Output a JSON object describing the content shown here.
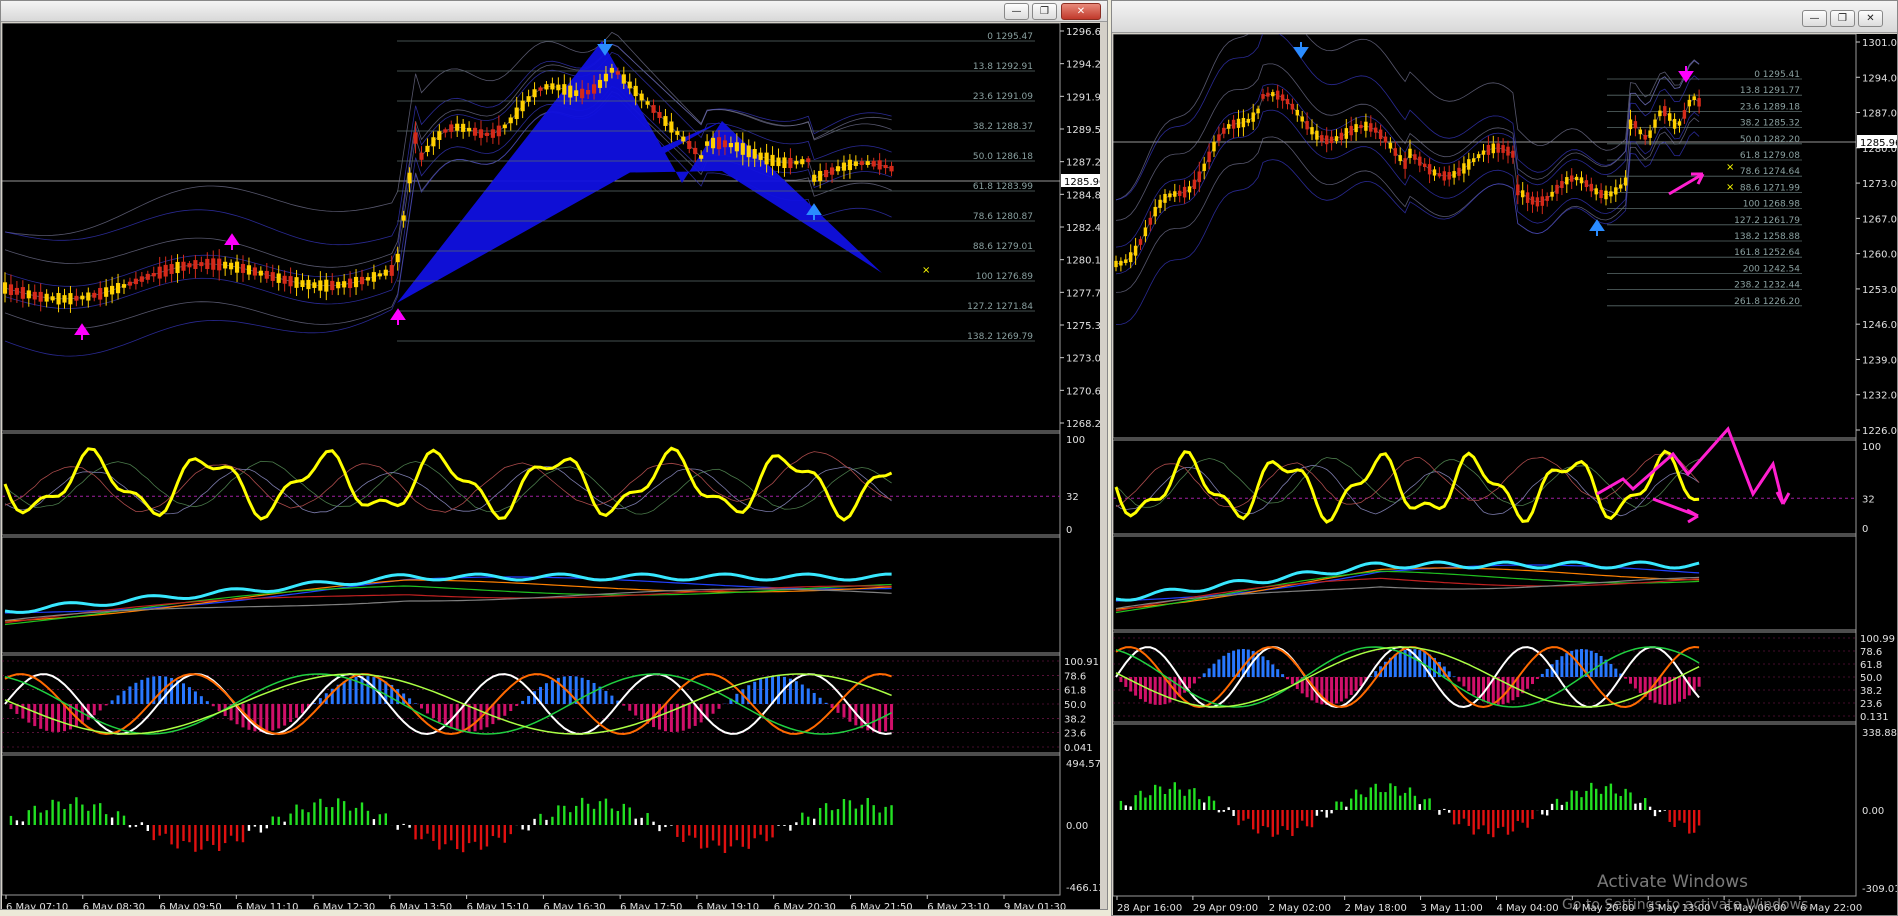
{
  "windows": {
    "left": {
      "main_price_labels": [
        "1296.65",
        "1294.25",
        "1291.90",
        "1289.55",
        "1287.20",
        "1284.80",
        "1282.45",
        "1280.10",
        "1277.75",
        "1275.35",
        "1273.00",
        "1270.65",
        "1268.25"
      ],
      "current_price": "1285.96",
      "fib_labels": [
        "0 1295.47",
        "13.8 1292.91",
        "23.6 1291.09",
        "38.2 1288.37",
        "50.0 1286.18",
        "61.8 1283.99",
        "78.6 1280.87",
        "88.6 1279.01",
        "100 1276.89",
        "127.2 1271.84",
        "138.2 1269.79"
      ],
      "rsi_labels": [
        "100",
        "32",
        "0"
      ],
      "stoch_labels": [
        "100.91",
        "78.6",
        "61.8",
        "50.0",
        "38.2",
        "23.6",
        "0.041"
      ],
      "hist_labels": [
        "494.57",
        "0.00",
        "-466.13"
      ],
      "time_labels": [
        "6 May 07:10",
        "6 May 08:30",
        "6 May 09:50",
        "6 May 11:10",
        "6 May 12:30",
        "6 May 13:50",
        "6 May 15:10",
        "6 May 16:30",
        "6 May 17:50",
        "6 May 19:10",
        "6 May 20:30",
        "6 May 21:50",
        "6 May 23:10",
        "9 May 01:30"
      ]
    },
    "right": {
      "main_price_labels": [
        "1301.00",
        "1294.00",
        "1287.00",
        "1280.00",
        "1273.00",
        "1267.00",
        "1260.00",
        "1253.00",
        "1246.00",
        "1239.00",
        "1232.00",
        "1226.00"
      ],
      "current_price": "1285.96",
      "fib_labels": [
        "0 1295.41",
        "13.8 1291.77",
        "23.6 1289.18",
        "38.2 1285.32",
        "50.0 1282.20",
        "61.8 1279.08",
        "78.6 1274.64",
        "88.6 1271.99",
        "100 1268.98",
        "127.2 1261.79",
        "138.2 1258.88",
        "161.8 1252.64",
        "200 1242.54",
        "238.2 1232.44",
        "261.8 1226.20"
      ],
      "rsi_labels": [
        "100",
        "32",
        "0"
      ],
      "stoch_labels": [
        "100.99",
        "78.6",
        "61.8",
        "50.0",
        "38.2",
        "23.6",
        "0.131"
      ],
      "hist_labels": [
        "338.88",
        "0.00",
        "-309.01"
      ],
      "time_labels": [
        "28 Apr 16:00",
        "29 Apr 09:00",
        "2 May 02:00",
        "2 May 18:00",
        "3 May 11:00",
        "4 May 04:00",
        "4 May 20:00",
        "5 May 13:00",
        "6 May 06:00",
        "6 May 22:00"
      ]
    }
  },
  "watermark": {
    "line1": "Activate Windows",
    "line2": "Go to Settings to activate Windows."
  },
  "colors": {
    "background": "#000000",
    "candle_up": "#ffd000",
    "candle_down": "#d42a1a",
    "rsi_line": "#ffff00",
    "cyan_line": "#38e8ff",
    "harmonic_fill": "#1010e0",
    "hist_up": "#22e022",
    "hist_down": "#e01010",
    "stoch_hist_up": "#2878ff",
    "stoch_hist_down": "#d0106a",
    "arrow_magenta": "#ff00ff",
    "arrow_blue": "#2a8cff"
  }
}
